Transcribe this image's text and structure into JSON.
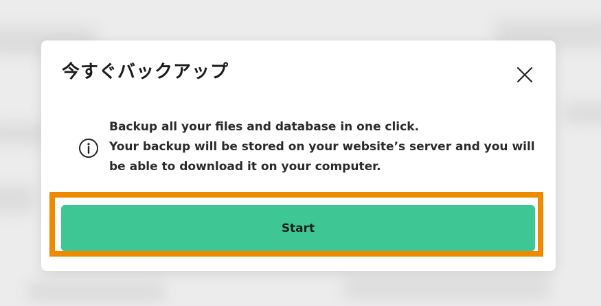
{
  "modal": {
    "title": "今すぐバックアップ",
    "close_icon": "close-icon",
    "info_icon": "info-icon",
    "info_lines": [
      "Backup all your files and database in one click.",
      "Your backup will be stored on your website’s server and you will",
      "be able to download it on your computer."
    ],
    "start_label": "Start"
  },
  "colors": {
    "accent_button": "#3ec795",
    "highlight_border": "#ee8a00",
    "text": "#1c1c1c"
  }
}
